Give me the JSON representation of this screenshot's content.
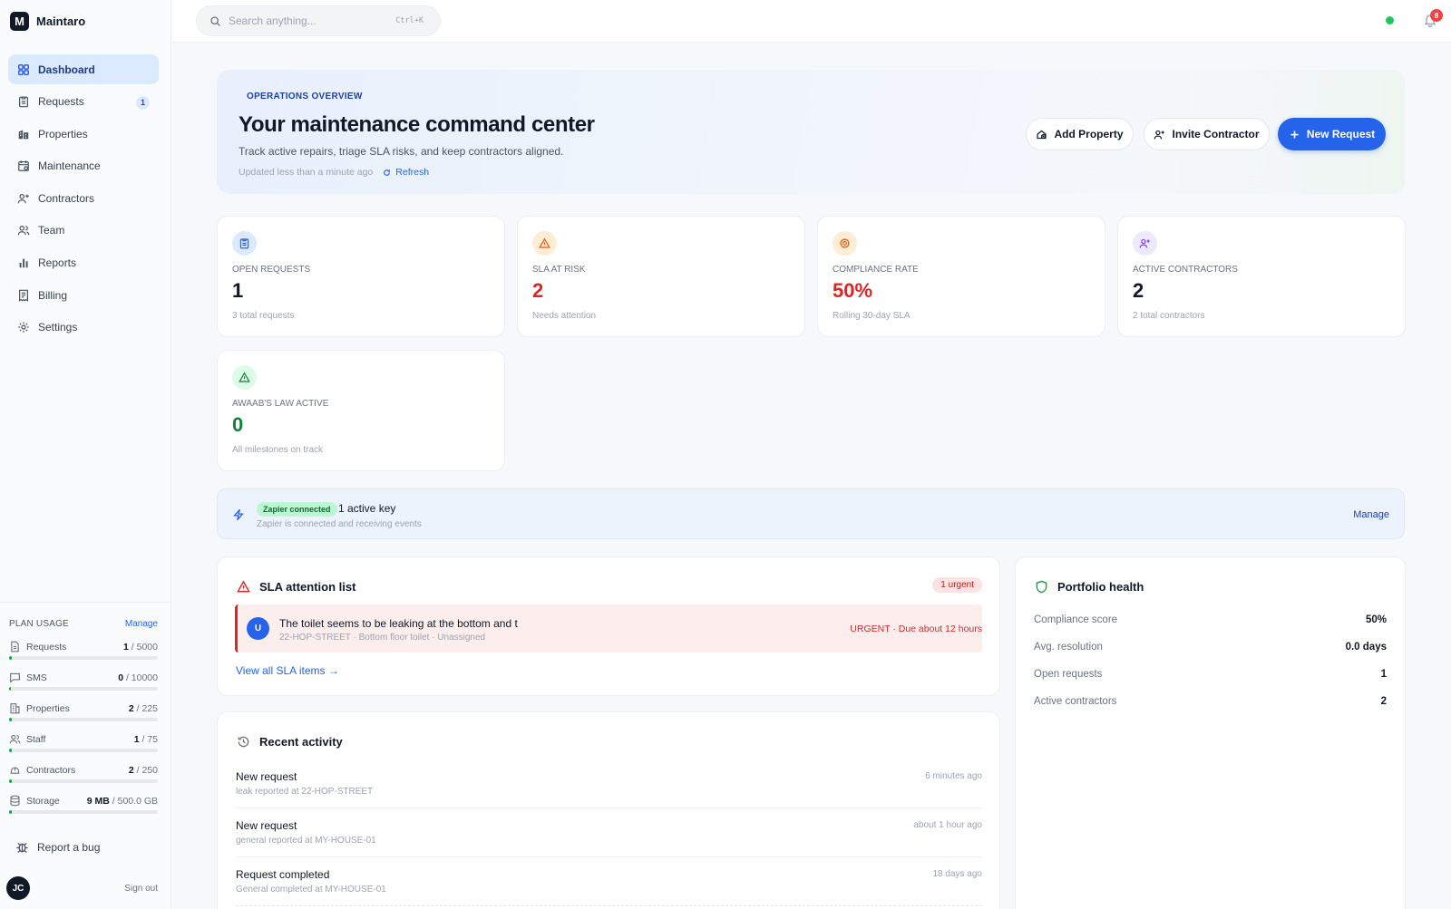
{
  "app": {
    "name": "Maintaro",
    "logo_letter": "M"
  },
  "sidebar": {
    "items": [
      {
        "label": "Dashboard",
        "icon": "grid-icon",
        "active": true
      },
      {
        "label": "Requests",
        "icon": "clipboard-icon",
        "badge": "1"
      },
      {
        "label": "Properties",
        "icon": "building-icon"
      },
      {
        "label": "Maintenance",
        "icon": "calendar-icon"
      },
      {
        "label": "Contractors",
        "icon": "user-plus-icon"
      },
      {
        "label": "Team",
        "icon": "users-icon"
      },
      {
        "label": "Reports",
        "icon": "bar-chart-icon"
      },
      {
        "label": "Billing",
        "icon": "receipt-icon"
      },
      {
        "label": "Settings",
        "icon": "gear-icon"
      }
    ],
    "plan": {
      "title": "PLAN USAGE",
      "manage": "Manage",
      "usage": [
        {
          "label": "Requests",
          "used": "1",
          "limit": "/ 5000",
          "fraction": 0.0002,
          "icon": "document-icon"
        },
        {
          "label": "SMS",
          "used": "0",
          "limit": "/ 10000",
          "fraction": 0,
          "icon": "message-icon"
        },
        {
          "label": "Properties",
          "used": "2",
          "limit": "/ 225",
          "fraction": 0.009,
          "icon": "building-icon"
        },
        {
          "label": "Staff",
          "used": "1",
          "limit": "/ 75",
          "fraction": 0.013,
          "icon": "users-icon"
        },
        {
          "label": "Contractors",
          "used": "2",
          "limit": "/ 250",
          "fraction": 0.008,
          "icon": "hardhat-icon"
        },
        {
          "label": "Storage",
          "used": "9 MB",
          "limit": "/ 500.0 GB",
          "fraction": 2e-05,
          "icon": "database-icon"
        }
      ]
    },
    "report_bug": "Report a bug",
    "user_initials": "JC",
    "sign_out": "Sign out"
  },
  "topbar": {
    "search_placeholder": "Search anything...",
    "shortcut": "Ctrl+K",
    "notification_count": "8",
    "status_color": "#22c55e"
  },
  "hero": {
    "eyebrow": "OPERATIONS OVERVIEW",
    "title": "Your maintenance command center",
    "subtitle": "Track active repairs, triage SLA risks, and keep contractors aligned.",
    "updated": "Updated less than a minute ago",
    "refresh": "Refresh",
    "buttons": {
      "add_property": "Add Property",
      "invite_contractor": "Invite Contractor",
      "new_request": "New Request"
    }
  },
  "stats": [
    {
      "label": "OPEN REQUESTS",
      "value": "1",
      "foot": "3 total requests",
      "color": "#111827",
      "icon": "clipboard-icon"
    },
    {
      "label": "SLA AT RISK",
      "value": "2",
      "foot": "Needs attention",
      "color": "#dc2626",
      "icon": "warning-icon"
    },
    {
      "label": "COMPLIANCE RATE",
      "value": "50%",
      "foot": "Rolling 30-day SLA",
      "color": "#dc2626",
      "icon": "gear-icon"
    },
    {
      "label": "ACTIVE CONTRACTORS",
      "value": "2",
      "foot": "2 total contractors",
      "color": "#111827",
      "icon": "user-plus-icon"
    },
    {
      "label": "AWAAB'S LAW ACTIVE",
      "value": "0",
      "foot": "All milestones on track",
      "color": "#15803d",
      "icon": "warning-icon"
    }
  ],
  "zapier": {
    "badge": "Zapier connected",
    "title": "1 active key",
    "subtitle": "Zapier is connected and receiving events",
    "manage": "Manage"
  },
  "sla": {
    "title": "SLA attention list",
    "badge": "1 urgent",
    "item": {
      "avatar": "U",
      "title": "The toilet seems to be leaking at the bottom and t",
      "subtitle": "22-HOP-STREET · Bottom floor toilet · Unassigned",
      "due": "URGENT · Due about 12 hours"
    },
    "view_all": "View all SLA items →"
  },
  "activity": {
    "title": "Recent activity",
    "items": [
      {
        "title": "New request",
        "subtitle": "leak reported at 22-HOP-STREET",
        "time": "6 minutes ago"
      },
      {
        "title": "New request",
        "subtitle": "general reported at MY-HOUSE-01",
        "time": "about 1 hour ago"
      },
      {
        "title": "Request completed",
        "subtitle": "General completed at MY-HOUSE-01",
        "time": "18 days ago"
      }
    ]
  },
  "portfolio": {
    "title": "Portfolio health",
    "rows": [
      {
        "label": "Compliance score",
        "value": "50%"
      },
      {
        "label": "Avg. resolution",
        "value": "0.0 days"
      },
      {
        "label": "Open requests",
        "value": "1"
      },
      {
        "label": "Active contractors",
        "value": "2"
      }
    ]
  }
}
